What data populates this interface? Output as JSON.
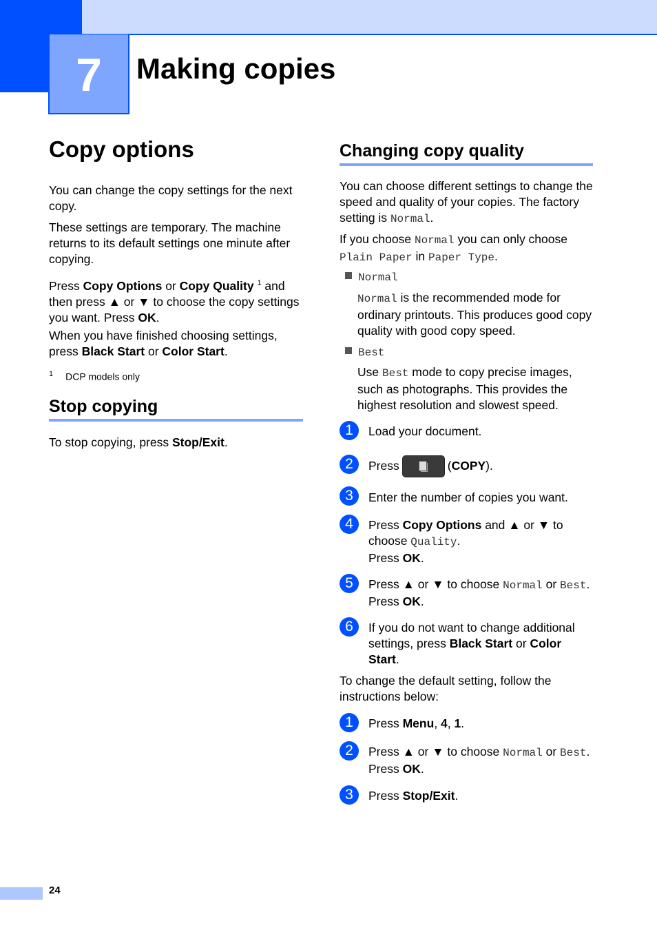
{
  "header": {
    "chapter_number": "7",
    "chapter_title": "Making copies"
  },
  "left": {
    "copy_options": {
      "title": "Copy options",
      "p1": "You can change the copy settings for the next copy.",
      "p2": "These settings are temporary. The machine returns to its default settings one minute after copying.",
      "p3": {
        "a": "Press ",
        "b1": "Copy Options",
        "c": " or ",
        "b2": "Copy Quality",
        "sup": "1",
        "d": " and then press ▲ or ▼ to choose the copy settings you want. Press ",
        "b3": "OK",
        "e": "."
      },
      "p4": {
        "a": "When you have finished choosing settings, press ",
        "b1": "Black Start",
        "c": " or ",
        "b2": "Color Start",
        "d": "."
      },
      "footnote": {
        "num": "1",
        "text": "DCP models only"
      }
    },
    "stop_copying": {
      "title": "Stop copying",
      "p": {
        "a": "To stop copying, press ",
        "b": "Stop/Exit",
        "c": "."
      }
    }
  },
  "right": {
    "title": "Changing copy quality",
    "p1": {
      "a": "You can choose different settings to change the speed and quality of your copies. The factory setting is ",
      "m": "Normal",
      "b": "."
    },
    "p2": {
      "a": "If you choose ",
      "m1": "Normal",
      "b": " you can only choose ",
      "m2": "Plain Paper",
      "c": " in ",
      "m3": "Paper Type",
      "d": "."
    },
    "bullets": [
      {
        "label": "Normal",
        "desc_m": "Normal",
        "desc": " is the recommended mode for ordinary printouts. This produces good copy quality with good copy speed."
      },
      {
        "label": "Best",
        "desc_a": "Use ",
        "desc_m": "Best",
        "desc": " mode to copy precise images, such as photographs. This provides the highest resolution and slowest speed."
      }
    ],
    "steps": [
      {
        "num": "1",
        "text": "Load your document."
      },
      {
        "num": "2",
        "a": "Press",
        "button_icon": "copy-icon",
        "b": "(",
        "bold": "COPY",
        "c": ")."
      },
      {
        "num": "3",
        "text": "Enter the number of copies you want."
      },
      {
        "num": "4",
        "a": "Press ",
        "bold1": "Copy Options",
        "b": " and ▲ or ▼ to choose ",
        "m": "Quality",
        "c": ".",
        "d": "Press ",
        "bold2": "OK",
        "e": "."
      },
      {
        "num": "5",
        "a": "Press ▲ or ▼ to choose ",
        "m1": "Normal",
        "b": " or ",
        "m2": "Best",
        "c": ".",
        "d": "Press ",
        "bold": "OK",
        "e": "."
      },
      {
        "num": "6",
        "a": "If you do not want to change additional settings, press ",
        "bold1": "Black Start",
        "b": " or ",
        "bold2": "Color Start",
        "c": "."
      }
    ],
    "default_intro": "To change the default setting, follow the instructions below:",
    "default_steps": [
      {
        "num": "1",
        "a": "Press ",
        "bold1": "Menu",
        "b": ", ",
        "bold2": "4",
        "c": ", ",
        "bold3": "1",
        "d": "."
      },
      {
        "num": "2",
        "a": "Press ▲ or ▼ to choose ",
        "m1": "Normal",
        "b": " or ",
        "m2": "Best",
        "c": ".",
        "d": "Press ",
        "bold": "OK",
        "e": "."
      },
      {
        "num": "3",
        "a": "Press ",
        "bold": "Stop/Exit",
        "b": "."
      }
    ]
  },
  "footer": {
    "page_number": "24"
  }
}
